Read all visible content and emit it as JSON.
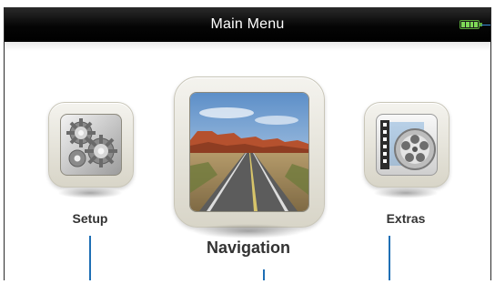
{
  "header": {
    "title": "Main Menu",
    "battery_icon": "battery-full-icon",
    "colors": {
      "bar": "#000000",
      "battery": "#7ed957",
      "accent": "#1f6fb5"
    }
  },
  "menu": {
    "items": [
      {
        "label": "Setup",
        "icon": "gears-icon"
      },
      {
        "label": "Navigation",
        "icon": "road-landscape-icon",
        "selected": true
      },
      {
        "label": "Extras",
        "icon": "film-reel-icon"
      }
    ]
  }
}
